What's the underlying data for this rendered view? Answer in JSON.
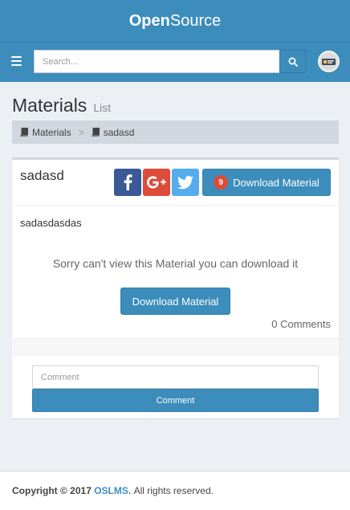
{
  "header": {
    "brand_bold": "Open",
    "brand_rest": "Source"
  },
  "navbar": {
    "search_placeholder": "Search..."
  },
  "page": {
    "title": "Materials",
    "subtitle": "List"
  },
  "breadcrumb": {
    "items": [
      {
        "label": "Materials"
      },
      {
        "label": "sadasd"
      }
    ],
    "separator": ">"
  },
  "material": {
    "title": "sadasd",
    "description": "sadasdasdas",
    "notice": "Sorry can't view this Material you can download it",
    "download_label": "Download Material",
    "download_count": "9",
    "comments_count": "0 Comments"
  },
  "comment_form": {
    "placeholder": "Comment",
    "button_label": "Comment"
  },
  "footer": {
    "copyright": "Copyright © 2017",
    "site": "OSLMS.",
    "rights": "All rights reserved."
  },
  "colors": {
    "primary": "#3c8dbc",
    "facebook": "#3b5998",
    "google_plus": "#dd4b39",
    "twitter": "#55acee",
    "badge": "#dd4b39"
  },
  "icons": {
    "menu": "hamburger-icon",
    "search": "search-icon",
    "book": "book-icon",
    "facebook": "facebook-icon",
    "google_plus": "google-plus-icon",
    "twitter": "twitter-icon"
  }
}
